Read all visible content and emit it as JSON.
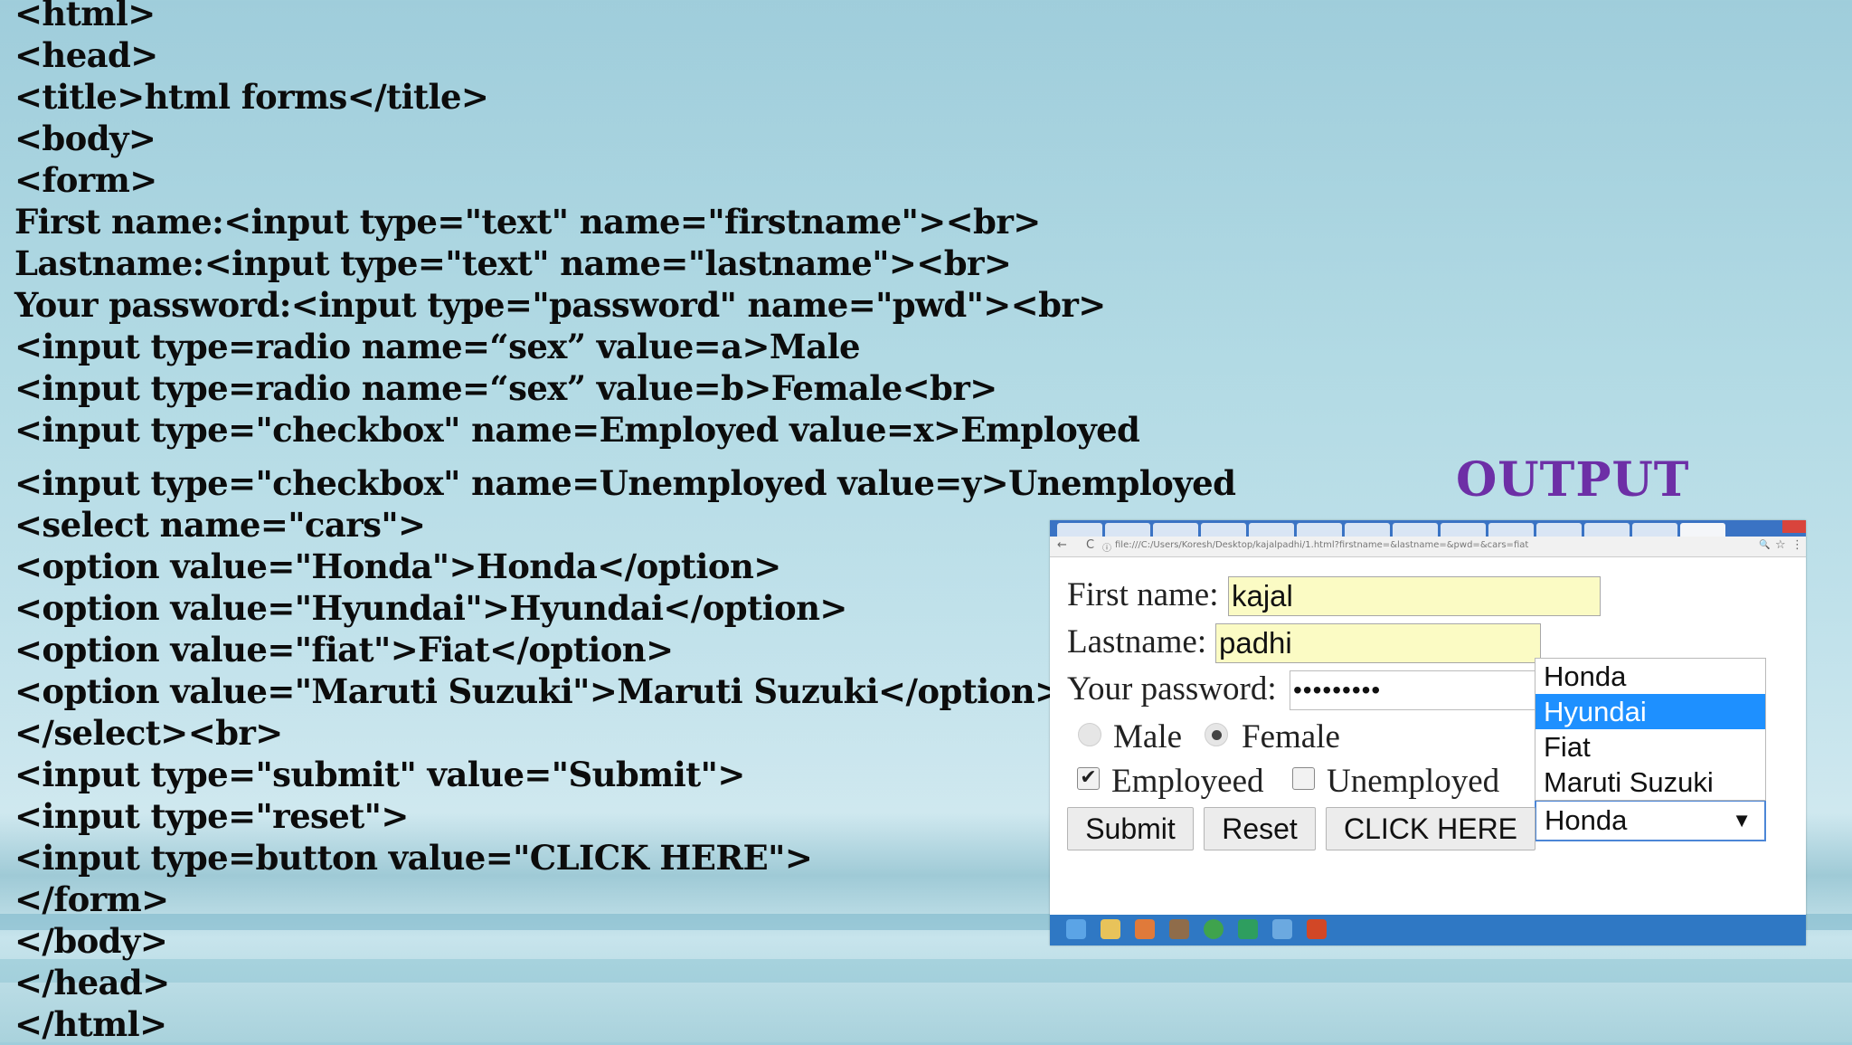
{
  "code_lines": [
    "<html>",
    "<head>",
    "<title>html forms</title>",
    "<body>",
    "<form>",
    "First name:<input type=\"text\" name=\"firstname\"><br>",
    "Lastname:<input type=\"text\" name=\"lastname\"><br>",
    "Your password:<input type=\"password\" name=\"pwd\"><br>",
    "<input type=radio name=“sex” value=a>Male",
    "<input type=radio name=“sex” value=b>Female<br>",
    "<input type=\"checkbox\" name=Employed value=x>Employed",
    "<input type=\"checkbox\" name=Unemployed value=y>Unemployed",
    "<select name=\"cars\">",
    "<option value=\"Honda\">Honda</option>",
    "<option value=\"Hyundai\">Hyundai</option>",
    "<option value=\"fiat\">Fiat</option>",
    "<option value=\"Maruti Suzuki\">Maruti Suzuki</option>",
    "</select><br>",
    "<input type=\"submit\" value=\"Submit\">",
    "<input type=\"reset\">",
    "<input type=button value=\"CLICK HERE\">",
    "</form>",
    "</body>",
    "</head>",
    "</html>"
  ],
  "output_heading": "OUTPUT",
  "browser": {
    "url": "file:///C:/Users/Koresh/Desktop/kajalpadhi/1.html?firstname=&lastname=&pwd=&cars=fiat",
    "form": {
      "first_name_label": "First name:",
      "first_name_value": "kajal",
      "lastname_label": "Lastname:",
      "lastname_value": "padhi",
      "password_label": "Your password:",
      "password_value": "•••••••••",
      "radio_male_label": "Male",
      "radio_female_label": "Female",
      "radio_selected": "Female",
      "checkbox_employed_label": "Employeed",
      "checkbox_employed_checked": true,
      "checkbox_unemployed_label": "Unemployed",
      "checkbox_unemployed_checked": false,
      "select_value": "Honda",
      "select_options": [
        "Honda",
        "Hyundai",
        "Fiat",
        "Maruti Suzuki"
      ],
      "highlighted_option": "Hyundai",
      "submit_label": "Submit",
      "reset_label": "Reset",
      "button_label": "CLICK HERE",
      "checkmark": "✔",
      "dropdown_arrow": "▼"
    },
    "icons": {
      "back": "←",
      "reload": "C",
      "info": "ⓘ",
      "zoom": "🔍",
      "star": "☆",
      "menu": "⋮"
    },
    "colors": {
      "tabstrip": "#3a73c4",
      "taskbar": "#2f78c4",
      "field_fill": "#fbfbc4",
      "highlight": "#1e90ff",
      "heading": "#6d2fa6"
    }
  }
}
